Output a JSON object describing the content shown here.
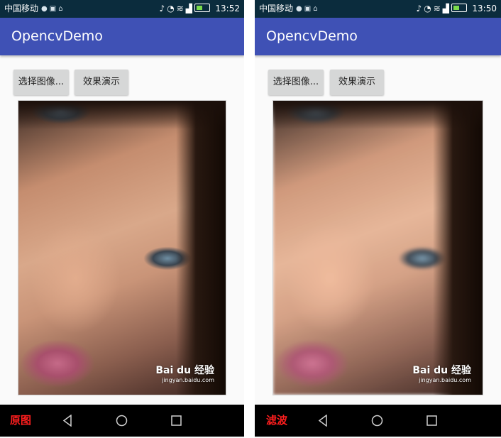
{
  "left_screen": {
    "status": {
      "carrier": "中国移动",
      "time": "13:52"
    },
    "app_title": "OpencvDemo",
    "buttons": {
      "select_image": "选择图像...",
      "demo": "效果演示"
    },
    "watermark": {
      "brand": "Bai du 经验",
      "url": "jingyan.baidu.com"
    },
    "caption": "原图"
  },
  "right_screen": {
    "status": {
      "carrier": "中国移动",
      "time": "13:50"
    },
    "app_title": "OpencvDemo",
    "buttons": {
      "select_image": "选择图像...",
      "demo": "效果演示"
    },
    "watermark": {
      "brand": "Bai du 经验",
      "url": "jingyan.baidu.com"
    },
    "caption": "滤波"
  },
  "colors": {
    "app_bar": "#3f51b5",
    "status_bar": "#0b2c3d",
    "caption": "#ff1e1e",
    "button": "#d6d7d7"
  },
  "icons": [
    "wechat-icon",
    "mail-icon",
    "android-icon",
    "mute-icon",
    "alarm-icon",
    "wifi-icon",
    "signal-icon",
    "battery-icon",
    "back-icon",
    "home-icon",
    "recents-icon"
  ]
}
